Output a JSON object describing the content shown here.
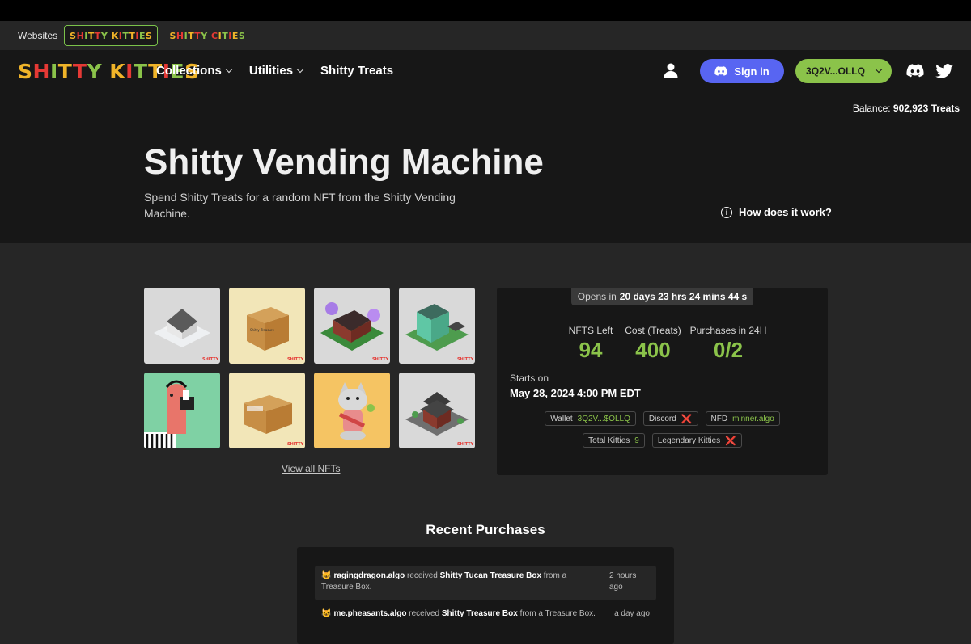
{
  "sitesbar": {
    "label": "Websites",
    "sites": [
      "SHITTY KITTIES",
      "SHITTY CITIES"
    ]
  },
  "nav": {
    "brand": "SHITTY KITTIES",
    "links": [
      "Collections",
      "Utilities",
      "Shitty Treats"
    ],
    "signin_label": "Sign in",
    "wallet_label": "3Q2V...OLLQ"
  },
  "hero": {
    "balance_label": "Balance:",
    "balance_value": "902,923 Treats",
    "title": "Shitty Vending Machine",
    "description": "Spend Shitty Treats for a random NFT from the Shitty Vending Machine.",
    "how_label": "How does it work?"
  },
  "gallery": {
    "view_all": "View all NFTs",
    "tile_watermark": "SHITTY CITIES"
  },
  "panel": {
    "opens_prefix": "Opens in",
    "opens_value": "20 days 23 hrs 24 mins 44 s",
    "stats": [
      {
        "label": "NFTS Left",
        "value": "94"
      },
      {
        "label": "Cost (Treats)",
        "value": "400"
      },
      {
        "label": "Purchases in 24H",
        "value": "0/2"
      }
    ],
    "starts_label": "Starts on",
    "starts_date": "May 28, 2024 4:00 PM EDT",
    "badges": {
      "wallet_label": "Wallet",
      "wallet_value": "3Q2V...$OLLQ",
      "discord_label": "Discord",
      "nfd_label": "NFD",
      "nfd_value": "minner.algo",
      "total_label": "Total Kitties",
      "total_value": "9",
      "legendary_label": "Legendary Kitties",
      "fail_mark": "❌"
    }
  },
  "recent": {
    "title": "Recent Purchases",
    "items": [
      {
        "user": "ragingdragon.algo",
        "verb": "received",
        "item": "Shitty Tucan Treasure Box",
        "suffix": "from a Treasure Box.",
        "time": "2 hours ago"
      },
      {
        "user": "me.pheasants.algo",
        "verb": "received",
        "item": "Shitty Treasure Box",
        "suffix": "from a Treasure Box.",
        "time": "a day ago"
      }
    ],
    "emoji": "😺"
  },
  "colors": {
    "accent": "#8bc34a",
    "discord": "#5865f2",
    "fail": "#e53935"
  }
}
